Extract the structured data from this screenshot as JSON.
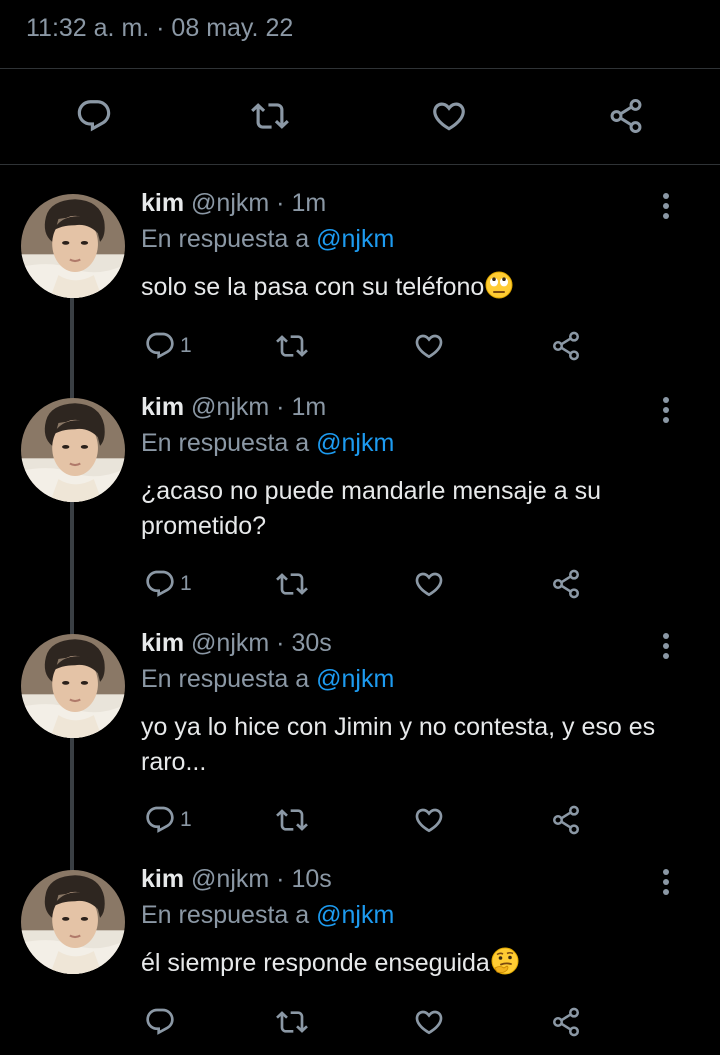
{
  "detail": {
    "timestamp": "11:32 a. m. · 08 may. 22"
  },
  "colors": {
    "background": "#000000",
    "text": "#e7e9ea",
    "secondary": "#8b98a5",
    "accent": "#1d9bf0",
    "divider": "#2f3336"
  },
  "icons": {
    "reply": "reply-icon",
    "retweet": "retweet-icon",
    "like": "heart-icon",
    "share": "share-icon",
    "more": "more-vertical-icon"
  },
  "replies": [
    {
      "name": "kim",
      "handle": "@njkm",
      "dot": "·",
      "time": "1m",
      "reply_prefix": "En respuesta a",
      "reply_to": "@njkm",
      "text": "solo se la pasa con su teléfono",
      "emoji": "face-with-rolling-eyes",
      "reply_count": "1"
    },
    {
      "name": "kim",
      "handle": "@njkm",
      "dot": "·",
      "time": "1m",
      "reply_prefix": "En respuesta a",
      "reply_to": "@njkm",
      "text": "¿acaso no puede mandarle mensaje a su prometido?",
      "emoji": "",
      "reply_count": "1"
    },
    {
      "name": "kim",
      "handle": "@njkm",
      "dot": "·",
      "time": "30s",
      "reply_prefix": "En respuesta a",
      "reply_to": "@njkm",
      "text": "yo ya lo hice con Jimin y no contesta, y eso es raro...",
      "emoji": "",
      "reply_count": "1"
    },
    {
      "name": "kim",
      "handle": "@njkm",
      "dot": "·",
      "time": "10s",
      "reply_prefix": "En respuesta a",
      "reply_to": "@njkm",
      "text": "él siempre responde enseguida",
      "emoji": "thinking-face",
      "reply_count": ""
    }
  ]
}
